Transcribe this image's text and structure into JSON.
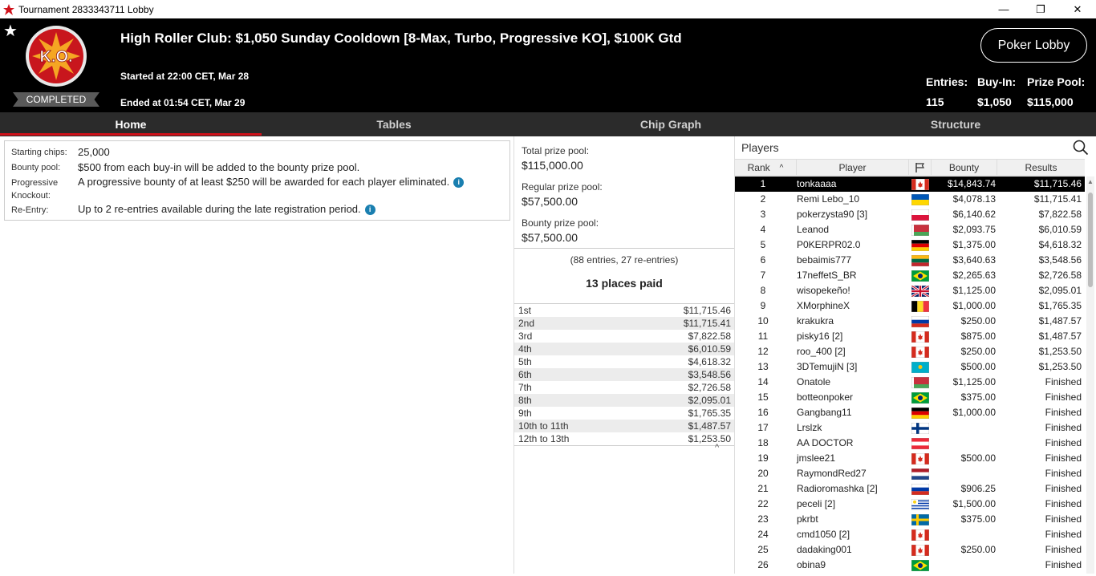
{
  "window": {
    "title": "Tournament 2833343711 Lobby",
    "minimize": "—",
    "restore": "❐",
    "close": "✕"
  },
  "header": {
    "star": "★",
    "logo_text": "K.O.",
    "status": "COMPLETED",
    "title": "High Roller Club: $1,050 Sunday Cooldown [8-Max, Turbo, Progressive KO], $100K Gtd",
    "started": "Started at 22:00 CET, Mar 28",
    "ended": "Ended at 01:54 CET, Mar 29",
    "lobby_button": "Poker Lobby",
    "entries_label": "Entries:",
    "entries_value": "115",
    "buyin_label": "Buy-In:",
    "buyin_value": "$1,050",
    "prizepool_label": "Prize Pool:",
    "prizepool_value": "$115,000"
  },
  "tabs": [
    "Home",
    "Tables",
    "Chip Graph",
    "Structure"
  ],
  "info": {
    "chips_label": "Starting chips:",
    "chips_value": "25,000",
    "bounty_label": "Bounty pool:",
    "bounty_value": "$500 from each buy-in will be added to the bounty prize pool.",
    "pko_label_1": "Progressive",
    "pko_label_2": "Knockout:",
    "pko_value": "A progressive bounty of at least $250 will be awarded for each player eliminated.",
    "reentry_label": "Re-Entry:",
    "reentry_value": "Up to 2 re-entries available during the late registration period.",
    "info_glyph": "i"
  },
  "prize": {
    "total_label": "Total prize pool:",
    "total_value": "$115,000.00",
    "regular_label": "Regular prize pool:",
    "regular_value": "$57,500.00",
    "bounty_label": "Bounty prize pool:",
    "bounty_value": "$57,500.00",
    "entries_note": "(88 entries, 27 re-entries)",
    "places_paid": "13 places paid",
    "collapse_glyph": "^",
    "payouts": [
      {
        "place": "1st",
        "amount": "$11,715.46"
      },
      {
        "place": "2nd",
        "amount": "$11,715.41"
      },
      {
        "place": "3rd",
        "amount": "$7,822.58"
      },
      {
        "place": "4th",
        "amount": "$6,010.59"
      },
      {
        "place": "5th",
        "amount": "$4,618.32"
      },
      {
        "place": "6th",
        "amount": "$3,548.56"
      },
      {
        "place": "7th",
        "amount": "$2,726.58"
      },
      {
        "place": "8th",
        "amount": "$2,095.01"
      },
      {
        "place": "9th",
        "amount": "$1,765.35"
      },
      {
        "place": "10th to 11th",
        "amount": "$1,487.57"
      },
      {
        "place": "12th to 13th",
        "amount": "$1,253.50"
      }
    ]
  },
  "players": {
    "title": "Players",
    "columns": {
      "rank": "Rank",
      "player": "Player",
      "bounty": "Bounty",
      "results": "Results"
    },
    "sort_glyph": "^",
    "rows": [
      {
        "rank": "1",
        "name": "tonkaaaa",
        "flag": "CA",
        "bounty": "$14,843.74",
        "result": "$11,715.46"
      },
      {
        "rank": "2",
        "name": "Remi Lebo_10",
        "flag": "UA",
        "bounty": "$4,078.13",
        "result": "$11,715.41"
      },
      {
        "rank": "3",
        "name": "pokerzysta90 [3]",
        "flag": "PL",
        "bounty": "$6,140.62",
        "result": "$7,822.58"
      },
      {
        "rank": "4",
        "name": "Leanod",
        "flag": "BY",
        "bounty": "$2,093.75",
        "result": "$6,010.59"
      },
      {
        "rank": "5",
        "name": "P0KERPR02.0",
        "flag": "DE",
        "bounty": "$1,375.00",
        "result": "$4,618.32"
      },
      {
        "rank": "6",
        "name": "bebaimis777",
        "flag": "LT",
        "bounty": "$3,640.63",
        "result": "$3,548.56"
      },
      {
        "rank": "7",
        "name": "17neffetS_BR",
        "flag": "BR",
        "bounty": "$2,265.63",
        "result": "$2,726.58"
      },
      {
        "rank": "8",
        "name": "wisopekeño!",
        "flag": "GB",
        "bounty": "$1,125.00",
        "result": "$2,095.01"
      },
      {
        "rank": "9",
        "name": "XMorphineX",
        "flag": "BE",
        "bounty": "$1,000.00",
        "result": "$1,765.35"
      },
      {
        "rank": "10",
        "name": "krakukra",
        "flag": "RU",
        "bounty": "$250.00",
        "result": "$1,487.57"
      },
      {
        "rank": "11",
        "name": "pisky16 [2]",
        "flag": "CA",
        "bounty": "$875.00",
        "result": "$1,487.57"
      },
      {
        "rank": "12",
        "name": "roo_400 [2]",
        "flag": "CA",
        "bounty": "$250.00",
        "result": "$1,253.50"
      },
      {
        "rank": "13",
        "name": "3DTemujiN [3]",
        "flag": "KZ",
        "bounty": "$500.00",
        "result": "$1,253.50"
      },
      {
        "rank": "14",
        "name": "Onatole",
        "flag": "BY",
        "bounty": "$1,125.00",
        "result": "Finished"
      },
      {
        "rank": "15",
        "name": "botteonpoker",
        "flag": "BR",
        "bounty": "$375.00",
        "result": "Finished"
      },
      {
        "rank": "16",
        "name": "Gangbang11",
        "flag": "DE",
        "bounty": "$1,000.00",
        "result": "Finished"
      },
      {
        "rank": "17",
        "name": "Lrslzk",
        "flag": "FI",
        "bounty": "",
        "result": "Finished"
      },
      {
        "rank": "18",
        "name": "AA DOCTOR",
        "flag": "AT",
        "bounty": "",
        "result": "Finished"
      },
      {
        "rank": "19",
        "name": "jmslee21",
        "flag": "CA",
        "bounty": "$500.00",
        "result": "Finished"
      },
      {
        "rank": "20",
        "name": "RaymondRed27",
        "flag": "NL",
        "bounty": "",
        "result": "Finished"
      },
      {
        "rank": "21",
        "name": "Radioromashka [2]",
        "flag": "RU",
        "bounty": "$906.25",
        "result": "Finished"
      },
      {
        "rank": "22",
        "name": "peceli [2]",
        "flag": "UY",
        "bounty": "$1,500.00",
        "result": "Finished"
      },
      {
        "rank": "23",
        "name": "pkrbt",
        "flag": "SE",
        "bounty": "$375.00",
        "result": "Finished"
      },
      {
        "rank": "24",
        "name": "cmd1050 [2]",
        "flag": "CA",
        "bounty": "",
        "result": "Finished"
      },
      {
        "rank": "25",
        "name": "dadaking001",
        "flag": "CA",
        "bounty": "$250.00",
        "result": "Finished"
      },
      {
        "rank": "26",
        "name": "obina9",
        "flag": "BR",
        "bounty": "",
        "result": "Finished"
      }
    ]
  },
  "colors": {
    "accent_red": "#d0121b",
    "header_bg": "#000000",
    "tab_bg": "#2b2b2b",
    "selected_row_bg": "#000000"
  }
}
